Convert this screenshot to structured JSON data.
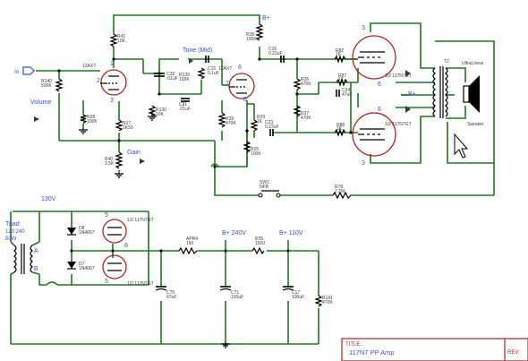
{
  "nets": {
    "b_plus_top": "B+",
    "b_plus_mid": "B+",
    "b_plus_240": "B+ 240V",
    "b_plus_110": "B+ 110V",
    "ac_130": "130V",
    "in_label": "In"
  },
  "controls": {
    "volume": "Volume",
    "tone": "Tone (Mid)",
    "gain": "Gain"
  },
  "transformer": {
    "name": "Triad",
    "spec1": "120:240",
    "spec2": "50W",
    "tap_a": "A",
    "tap_b": "B"
  },
  "tubes": {
    "v1": "12AX7",
    "v2": "12AX7",
    "power_top": "1/2 117N7GT",
    "power_bot": "1/2 117N7GT",
    "rect_top": "1/2 117N7GT",
    "rect_bot": "1/2 117N7GT"
  },
  "pins": [
    "1",
    "2",
    "3",
    "4",
    "5",
    "6",
    "7",
    "8",
    "3",
    "6",
    "6",
    "3",
    "5",
    "5",
    "8"
  ],
  "output": {
    "ot_ref": "T2",
    "ot_name": "UltraLinear",
    "speaker": "Speaker"
  },
  "parts": [
    {
      "ref": "R140",
      "val": "500K"
    },
    {
      "ref": "R41",
      "val": "10K"
    },
    {
      "ref": "R28",
      "val": "100K"
    },
    {
      "ref": "R27",
      "val": "1K50"
    },
    {
      "ref": "R40",
      "val": "3.5K"
    },
    {
      "ref": "C32",
      "val": ".01uF"
    },
    {
      "ref": "R130",
      "val": "10K"
    },
    {
      "ref": "R139",
      "val": "100K"
    },
    {
      "ref": "C81",
      "val": ".01uF"
    },
    {
      "ref": "C15",
      "val": "0.1uF"
    },
    {
      "ref": "R38",
      "val": "100K"
    },
    {
      "ref": "R39",
      "val": "470K"
    },
    {
      "ref": "R29",
      "val": "1K"
    },
    {
      "ref": "R25",
      "val": "100K"
    },
    {
      "ref": "C16",
      "val": "0.22uF"
    },
    {
      "ref": "C23",
      "val": "0.22uF"
    },
    {
      "ref": "R26",
      "val": "470K"
    },
    {
      "ref": "R37",
      "val": "470K"
    },
    {
      "ref": "R82",
      "val": "1K"
    },
    {
      "ref": "R87",
      "val": "1K"
    },
    {
      "ref": "C24",
      "val": "47uF"
    },
    {
      "ref": "R88",
      "val": "1K"
    },
    {
      "ref": "SW1",
      "val": "NFB"
    },
    {
      "ref": "R78",
      "val": "2.2M"
    },
    {
      "ref": "D8",
      "val": "1N4007"
    },
    {
      "ref": "D7",
      "val": "1N4007"
    },
    {
      "ref": "APR4",
      "val": "150"
    },
    {
      "ref": "R35",
      "val": "1500"
    },
    {
      "ref": "C70",
      "val": "47uF"
    },
    {
      "ref": "C71",
      "val": "100uF"
    },
    {
      "ref": "C17",
      "val": "100uF"
    },
    {
      "ref": "R141",
      "val": "470K"
    }
  ],
  "title_block": {
    "title_label": "TITLE:",
    "title_value": "117N7 PP Amp",
    "rev_label": "REV:"
  }
}
